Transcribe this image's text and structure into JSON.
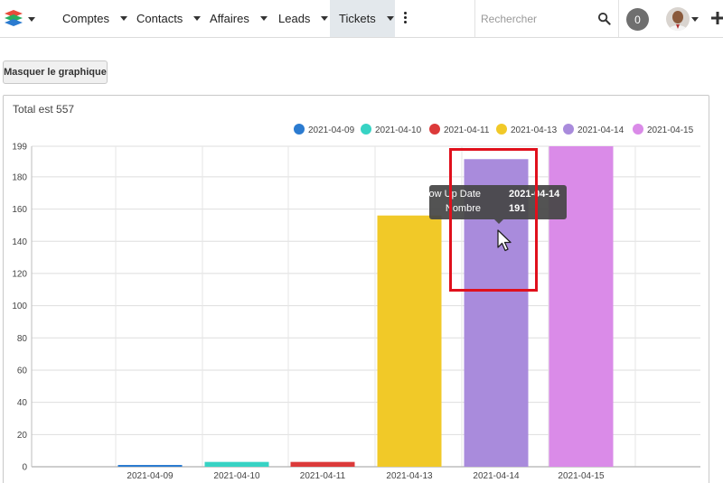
{
  "nav": {
    "items": [
      {
        "label": "Comptes",
        "active": false
      },
      {
        "label": "Contacts",
        "active": false
      },
      {
        "label": "Affaires",
        "active": false
      },
      {
        "label": "Leads",
        "active": false
      },
      {
        "label": "Tickets",
        "active": true
      }
    ],
    "search_placeholder": "Rechercher",
    "notification_count": "0"
  },
  "toolbar": {
    "hide_chart_label": "Masquer le graphique"
  },
  "chart": {
    "total_label": "Total est 557",
    "tooltip": {
      "row1_key": "Follow Up Date",
      "row1_value": "2021-04-14",
      "row2_key": "Nombre",
      "row2_value": "191"
    }
  },
  "chart_data": {
    "type": "bar",
    "categories": [
      "2021-04-09",
      "2021-04-10",
      "2021-04-11",
      "2021-04-13",
      "2021-04-14",
      "2021-04-15"
    ],
    "values": [
      1,
      3,
      3,
      156,
      191,
      199
    ],
    "colors": [
      "#2b7bd0",
      "#37d3c4",
      "#dc3a3a",
      "#f1c928",
      "#a98bdc",
      "#da8be8"
    ],
    "ylim": [
      0,
      199
    ],
    "yticks": [
      0,
      20,
      40,
      60,
      80,
      100,
      120,
      140,
      160,
      180,
      199
    ],
    "legend_position": "top-right",
    "grid": true
  }
}
